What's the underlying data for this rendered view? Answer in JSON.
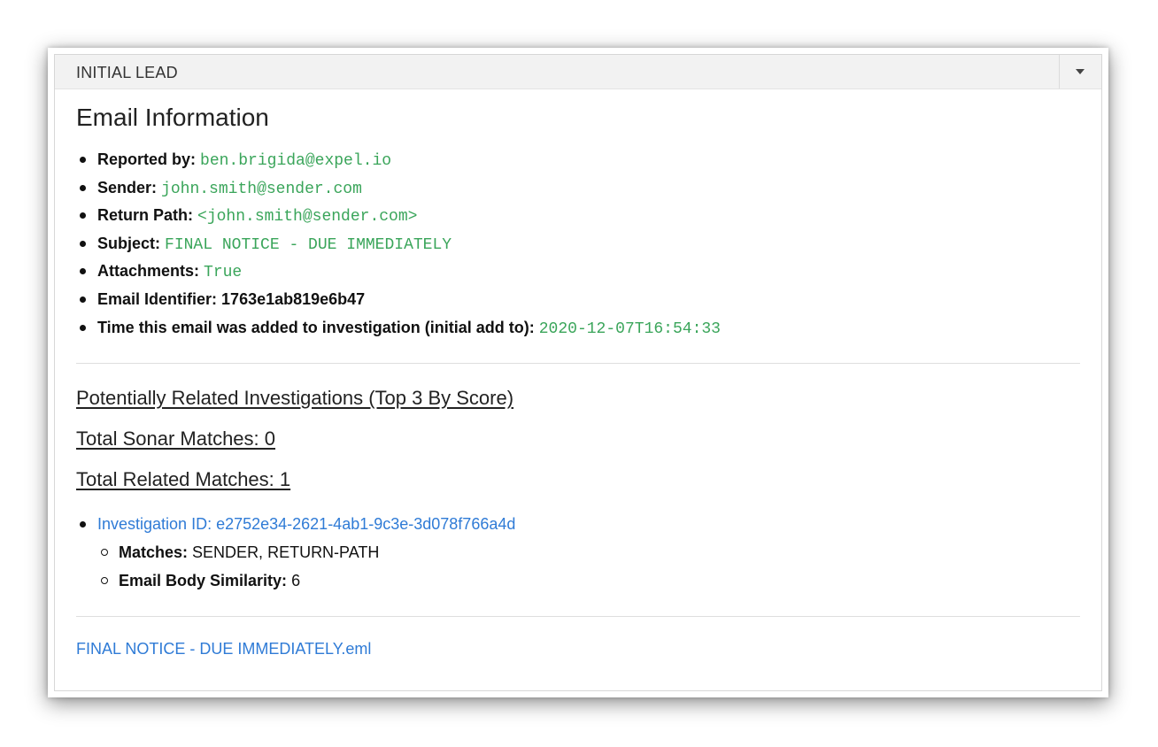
{
  "panel": {
    "title": "INITIAL LEAD"
  },
  "email_info": {
    "heading": "Email Information",
    "reported_by": {
      "label": "Reported by:",
      "value": "ben.brigida@expel.io"
    },
    "sender": {
      "label": "Sender:",
      "value": "john.smith@sender.com"
    },
    "return_path": {
      "label": "Return Path:",
      "value": "<john.smith@sender.com>"
    },
    "subject": {
      "label": "Subject:",
      "value": "FINAL NOTICE - DUE IMMEDIATELY"
    },
    "attachments": {
      "label": "Attachments:",
      "value": "True"
    },
    "email_identifier": {
      "label": "Email Identifier:",
      "value": "1763e1ab819e6b47"
    },
    "time_added": {
      "label": "Time this email was added to investigation (initial add to):",
      "value": "2020-12-07T16:54:33"
    }
  },
  "related": {
    "title": "Potentially Related Investigations (Top 3 By Score)",
    "sonar_matches": "Total Sonar Matches: 0",
    "related_matches": "Total Related Matches: 1",
    "investigations": [
      {
        "link": "Investigation ID: e2752e34-2621-4ab1-9c3e-3d078f766a4d",
        "matches_label": "Matches:",
        "matches_value": "SENDER, RETURN-PATH",
        "similarity_label": "Email Body Similarity:",
        "similarity_value": "6"
      }
    ]
  },
  "attachment_file": "FINAL NOTICE - DUE IMMEDIATELY.eml",
  "colors": {
    "value_green": "#3aa55a",
    "link_blue": "#2f7bd6",
    "header_bg": "#f2f2f2"
  },
  "icons": {
    "toggle": "caret-down-icon"
  }
}
